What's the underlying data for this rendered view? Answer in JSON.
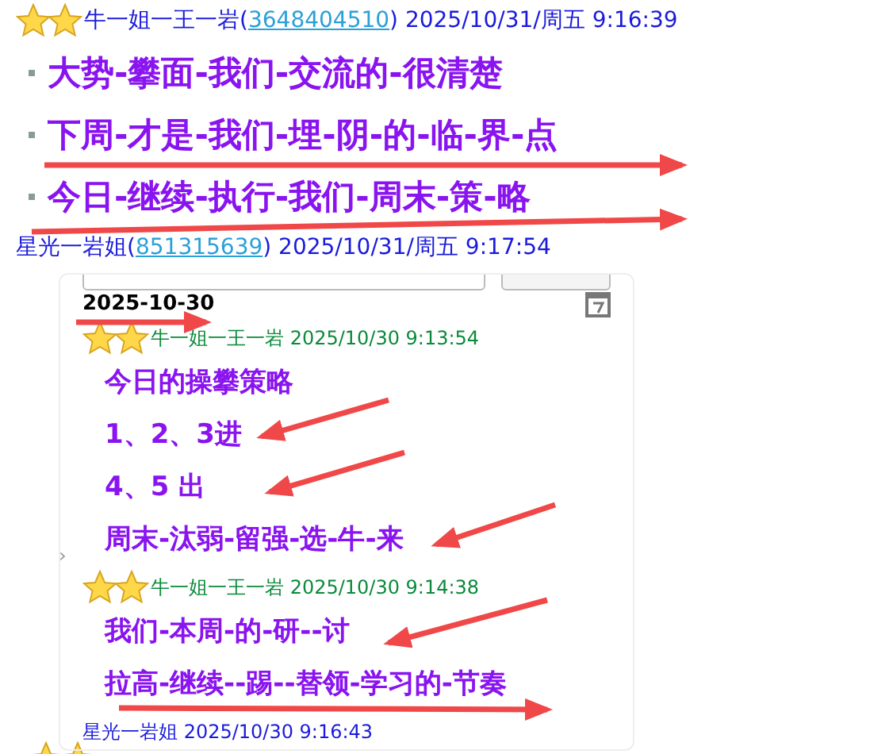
{
  "posts": [
    {
      "author": "牛一姐一王一岩(",
      "qq": "3648404510",
      "time": ") 2025/10/31/周五 9:16:39",
      "stars": true,
      "lines": [
        "大势-攀面-我们-交流的-很清楚",
        "下周-才是-我们-埋-阴-的-临-界-点",
        "今日-继续-执行-我们-周末-策-略"
      ]
    },
    {
      "author": "星光一岩姐(",
      "qq": "851315639",
      "time": ") 2025/10/31/周五 9:17:54",
      "stars": false
    }
  ],
  "quote": {
    "date": "2025-10-30",
    "chevron": "›",
    "messages": [
      {
        "header": "牛一姐一王一岩 2025/10/30 9:13:54",
        "stars": true,
        "lines": [
          "今日的操攀策略",
          "1、2、3进",
          "4、5 出",
          "周末-汰弱-留强-选-牛-来"
        ]
      },
      {
        "header": "牛一姐一王一岩 2025/10/30 9:14:38",
        "stars": true,
        "lines": [
          "我们-本周-的-研--讨",
          "拉高-继续--踢--替领-学习的-节奏"
        ]
      },
      {
        "header": "星光一岩姐 2025/10/30 9:16:43",
        "stars": false
      }
    ]
  }
}
